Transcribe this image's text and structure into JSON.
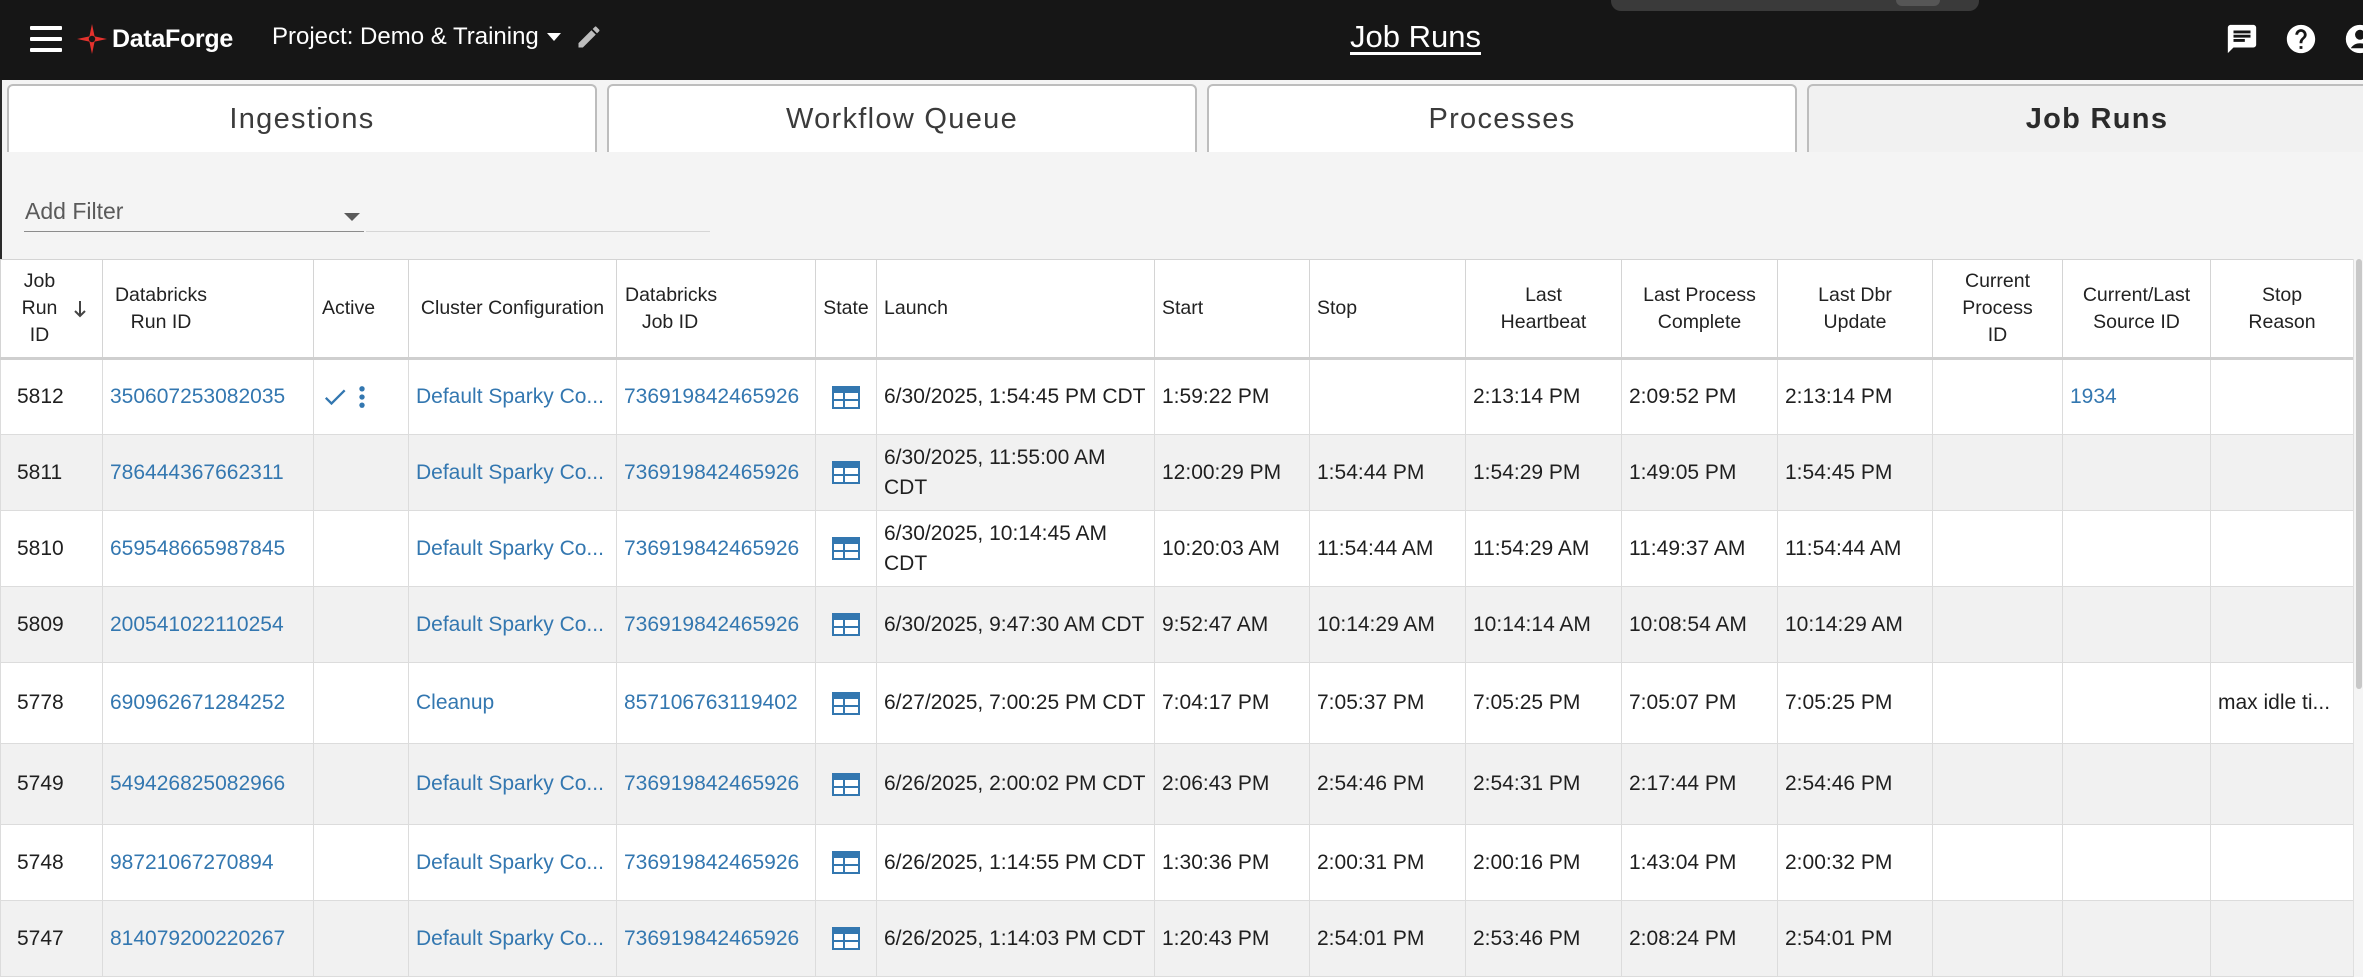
{
  "app": {
    "name": "DataForge",
    "project_label": "Project: Demo & Training",
    "page_title": "Job Runs",
    "brand_color": "#e5322d",
    "link_color": "#3377b0"
  },
  "tabs": [
    {
      "label": "Ingestions",
      "active": false
    },
    {
      "label": "Workflow Queue",
      "active": false
    },
    {
      "label": "Processes",
      "active": false
    },
    {
      "label": "Job Runs",
      "active": true
    }
  ],
  "filter": {
    "label": "Add Filter"
  },
  "columns": [
    "Job Run ID",
    "Databricks Run ID",
    "Active",
    "Cluster Configuration",
    "Databricks Job ID",
    "State",
    "Launch",
    "Start",
    "Stop",
    "Last Heartbeat",
    "Last Process Complete",
    "Last Dbr Update",
    "Current Process ID",
    "Current/Last Source ID",
    "Stop Reason"
  ],
  "rows": [
    {
      "job_run_id": "5812",
      "databricks_run_id": "350607253082035",
      "active": true,
      "cluster": "Default Sparky Co...",
      "job_id": "736919842465926",
      "state_icon": "table-icon",
      "launch": "6/30/2025, 1:54:45 PM CDT",
      "start": "1:59:22 PM",
      "stop": "",
      "last_heartbeat": "2:13:14 PM",
      "last_process_complete": "2:09:52 PM",
      "last_dbr_update": "2:13:14 PM",
      "current_process_id": "",
      "source_id": "1934",
      "stop_reason": ""
    },
    {
      "job_run_id": "5811",
      "databricks_run_id": "786444367662311",
      "active": false,
      "cluster": "Default Sparky Co...",
      "job_id": "736919842465926",
      "state_icon": "table-icon",
      "launch": "6/30/2025, 11:55:00 AM CDT",
      "start": "12:00:29 PM",
      "stop": "1:54:44 PM",
      "last_heartbeat": "1:54:29 PM",
      "last_process_complete": "1:49:05 PM",
      "last_dbr_update": "1:54:45 PM",
      "current_process_id": "",
      "source_id": "",
      "stop_reason": ""
    },
    {
      "job_run_id": "5810",
      "databricks_run_id": "659548665987845",
      "active": false,
      "cluster": "Default Sparky Co...",
      "job_id": "736919842465926",
      "state_icon": "table-icon",
      "launch": "6/30/2025, 10:14:45 AM CDT",
      "start": "10:20:03 AM",
      "stop": "11:54:44 AM",
      "last_heartbeat": "11:54:29 AM",
      "last_process_complete": "11:49:37 AM",
      "last_dbr_update": "11:54:44 AM",
      "current_process_id": "",
      "source_id": "",
      "stop_reason": ""
    },
    {
      "job_run_id": "5809",
      "databricks_run_id": "200541022110254",
      "active": false,
      "cluster": "Default Sparky Co...",
      "job_id": "736919842465926",
      "state_icon": "table-icon",
      "launch": "6/30/2025, 9:47:30 AM CDT",
      "start": "9:52:47 AM",
      "stop": "10:14:29 AM",
      "last_heartbeat": "10:14:14 AM",
      "last_process_complete": "10:08:54 AM",
      "last_dbr_update": "10:14:29 AM",
      "current_process_id": "",
      "source_id": "",
      "stop_reason": ""
    },
    {
      "job_run_id": "5778",
      "databricks_run_id": "690962671284252",
      "active": false,
      "cluster": "Cleanup",
      "job_id": "857106763119402",
      "state_icon": "table-icon",
      "launch": "6/27/2025, 7:00:25 PM CDT",
      "start": "7:04:17 PM",
      "stop": "7:05:37 PM",
      "last_heartbeat": "7:05:25 PM",
      "last_process_complete": "7:05:07 PM",
      "last_dbr_update": "7:05:25 PM",
      "current_process_id": "",
      "source_id": "",
      "stop_reason": "max idle ti..."
    },
    {
      "job_run_id": "5749",
      "databricks_run_id": "549426825082966",
      "active": false,
      "cluster": "Default Sparky Co...",
      "job_id": "736919842465926",
      "state_icon": "table-icon",
      "launch": "6/26/2025, 2:00:02 PM CDT",
      "start": "2:06:43 PM",
      "stop": "2:54:46 PM",
      "last_heartbeat": "2:54:31 PM",
      "last_process_complete": "2:17:44 PM",
      "last_dbr_update": "2:54:46 PM",
      "current_process_id": "",
      "source_id": "",
      "stop_reason": ""
    },
    {
      "job_run_id": "5748",
      "databricks_run_id": "98721067270894",
      "active": false,
      "cluster": "Default Sparky Co...",
      "job_id": "736919842465926",
      "state_icon": "table-icon",
      "launch": "6/26/2025, 1:14:55 PM CDT",
      "start": "1:30:36 PM",
      "stop": "2:00:31 PM",
      "last_heartbeat": "2:00:16 PM",
      "last_process_complete": "1:43:04 PM",
      "last_dbr_update": "2:00:32 PM",
      "current_process_id": "",
      "source_id": "",
      "stop_reason": ""
    },
    {
      "job_run_id": "5747",
      "databricks_run_id": "814079200220267",
      "active": false,
      "cluster": "Default Sparky Co...",
      "job_id": "736919842465926",
      "state_icon": "table-icon",
      "launch": "6/26/2025, 1:14:03 PM CDT",
      "start": "1:20:43 PM",
      "stop": "2:54:01 PM",
      "last_heartbeat": "2:53:46 PM",
      "last_process_complete": "2:08:24 PM",
      "last_dbr_update": "2:54:01 PM",
      "current_process_id": "",
      "source_id": "",
      "stop_reason": ""
    }
  ]
}
